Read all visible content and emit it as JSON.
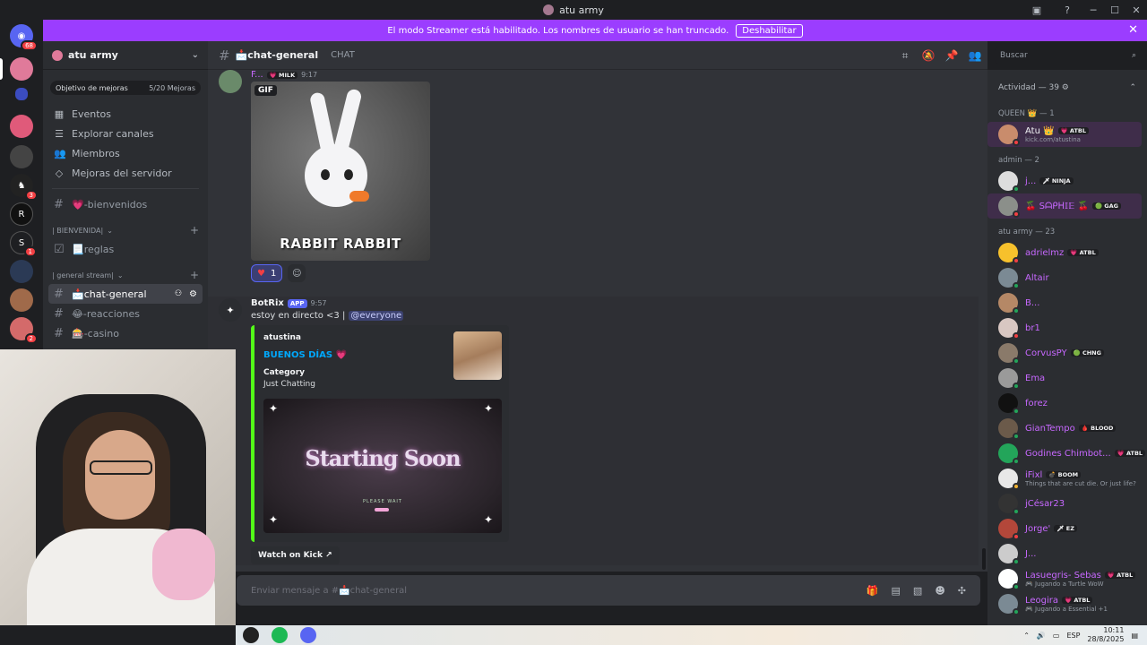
{
  "window": {
    "title": "atu army"
  },
  "banner": {
    "text": "El modo Streamer está habilitado. Los nombres de usuario se han truncado.",
    "button": "Deshabilitar"
  },
  "servers": {
    "home_badge": "68",
    "badges": [
      "3",
      "1",
      "2"
    ]
  },
  "sidebar": {
    "guild_name": "atu army",
    "boost": {
      "label": "Objetivo de mejoras",
      "count": "5/20 Mejoras"
    },
    "nav": [
      "Eventos",
      "Explorar canales",
      "Miembros",
      "Mejoras del servidor"
    ],
    "top_channel": "💗-bienvenidos",
    "cat1": "| BIENVENIDA|",
    "cat1_channels": [
      "📃reglas"
    ],
    "cat2": "| general stream|",
    "channels": [
      "📩chat-general",
      "😂-reacciones",
      "🎰-casino"
    ]
  },
  "chat": {
    "channel": "📩chat-general",
    "topic": "CHAT",
    "search_placeholder": "Buscar",
    "composer_placeholder": "Enviar mensaje a #📩chat-general",
    "msg1": {
      "author": "F...",
      "tag": "💗 MILK",
      "time": "9:17",
      "gif_label": "GIF",
      "gif_caption": "RABBIT RABBIT",
      "reaction_count": "1"
    },
    "msg2": {
      "author": "BotRix",
      "app_tag": "APP",
      "time": "9:57",
      "text": "estoy en directo <3 |",
      "mention": "@everyone",
      "embed": {
        "author": "atustina",
        "title": "BUENOS DÍAS 💗",
        "field_name": "Category",
        "field_value": "Just Chatting",
        "banner_text": "Starting Soon",
        "banner_sub": "PLEASE WAIT"
      },
      "button": "Watch on Kick ↗"
    }
  },
  "members": {
    "header": "Actividad — 39 ⚙",
    "roles": [
      {
        "name": "QUEEN 👑 — 1",
        "members": [
          {
            "name": "Atu 👑",
            "tag": "💗 ATBL",
            "sub": "kick.com/atustina",
            "color": "#f2f3f5",
            "av": "#c98c6c",
            "status": "#f23f43",
            "selected": true
          }
        ]
      },
      {
        "name": "admin — 2",
        "members": [
          {
            "name": "j...",
            "tag": "🗡 NINJA",
            "sub": "",
            "color": "#c768ff",
            "av": "#dddddd",
            "status": "#23a55a"
          },
          {
            "name": "🍒 Sᗩᑭᕼ𝕀𝔼 🍒",
            "tag": "🟢 GAG",
            "sub": "",
            "color": "#c768ff",
            "av": "#8b8f8a",
            "status": "#f23f43",
            "selected": true
          }
        ]
      },
      {
        "name": "atu army — 23",
        "members": [
          {
            "name": "adrielmz",
            "tag": "💗 ATBL",
            "sub": "",
            "color": "#c768ff",
            "av": "#f7c12c",
            "status": "#f23f43"
          },
          {
            "name": "Altair",
            "tag": "",
            "sub": "",
            "color": "#c768ff",
            "av": "#7b8a94",
            "status": "#23a55a"
          },
          {
            "name": "B...",
            "tag": "",
            "sub": "",
            "color": "#c768ff",
            "av": "#b58866",
            "status": "#23a55a"
          },
          {
            "name": "br1",
            "tag": "",
            "sub": "",
            "color": "#c768ff",
            "av": "#d8c7c2",
            "status": "#f23f43"
          },
          {
            "name": "CorvusPY",
            "tag": "🟢 CHNG",
            "sub": "",
            "color": "#c768ff",
            "av": "#8a7a6a",
            "status": "#23a55a"
          },
          {
            "name": "Ema",
            "tag": "",
            "sub": "",
            "color": "#c768ff",
            "av": "#9a9a9a",
            "status": "#23a55a"
          },
          {
            "name": "forez",
            "tag": "",
            "sub": "",
            "color": "#c768ff",
            "av": "#111111",
            "status": "#23a55a"
          },
          {
            "name": "GianTempo",
            "tag": "🩸 BLOOD",
            "sub": "",
            "color": "#c768ff",
            "av": "#6b5a4a",
            "status": "#23a55a"
          },
          {
            "name": "Godines Chimbot...",
            "tag": "💗 ATBL",
            "sub": "",
            "color": "#c768ff",
            "av": "#23a55a",
            "status": "#23a55a"
          },
          {
            "name": "iFixl",
            "tag": "💣 BOOM",
            "sub": "Things that are cut die. Or just life?",
            "color": "#c768ff",
            "av": "#e8e8e8",
            "status": "#f0b232"
          },
          {
            "name": "jCésar23",
            "tag": "",
            "sub": "",
            "color": "#c768ff",
            "av": "#333333",
            "status": "#23a55a"
          },
          {
            "name": "Jorge'",
            "tag": "🗡 EZ",
            "sub": "",
            "color": "#c768ff",
            "av": "#b3473a",
            "status": "#f23f43"
          },
          {
            "name": "J...",
            "tag": "",
            "sub": "",
            "color": "#c768ff",
            "av": "#cccccc",
            "status": "#23a55a"
          },
          {
            "name": "Lasuegris- Sebas",
            "tag": "💗 ATBL",
            "sub": "🎮 Jugando a Turtle WoW",
            "color": "#c768ff",
            "av": "#ffffff",
            "status": "#23a55a"
          },
          {
            "name": "Leogira",
            "tag": "💗 ATBL",
            "sub": "🎮 Jugando a Essential +1",
            "color": "#c768ff",
            "av": "#7b8a94",
            "status": "#23a55a"
          }
        ]
      }
    ]
  },
  "taskbar": {
    "lang": "ESP",
    "time": "10:11",
    "date": "28/8/2025"
  }
}
